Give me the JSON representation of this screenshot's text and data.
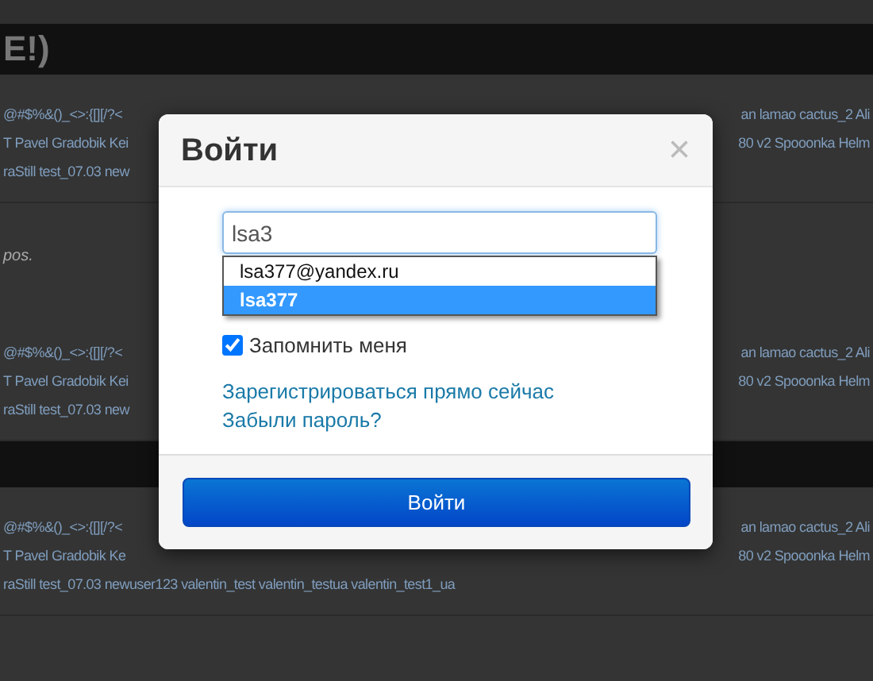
{
  "background": [
    {
      "kind": "heading",
      "text": "E!)"
    },
    {
      "kind": "posts",
      "lines": [
        {
          "left": "@#$%&()_<>:{[][/?<",
          "right": "an lamao cactus_2 Ali"
        },
        {
          "left": "T Pavel Gradobik Kei",
          "right": "80 v2 Spooonka Helm"
        },
        {
          "left": "raStill test_07.03 new"
        }
      ]
    },
    {
      "kind": "note",
      "text": "pos."
    },
    {
      "kind": "posts",
      "lines": [
        {
          "left": "@#$%&()_<>:{[][/?<",
          "right": "an lamao cactus_2 Ali"
        },
        {
          "left": "T Pavel Gradobik Kei",
          "right": "80 v2 Spooonka Helm"
        },
        {
          "left": "raStill test_07.03 new"
        }
      ]
    },
    {
      "kind": "heading"
    },
    {
      "kind": "posts",
      "lines": [
        {
          "left": "@#$%&()_<>:{[][/?<",
          "right": "an lamao cactus_2 Ali"
        },
        {
          "left": "T Pavel Gradobik Ke",
          "right": "80 v2 Spooonka Helm"
        },
        {
          "left": "raStill test_07.03 newuser123 valentin_test valentin_testua valentin_test1_ua"
        }
      ]
    }
  ],
  "dialog": {
    "title": "Войти",
    "close": "×",
    "login_field": {
      "value": "lsa3"
    },
    "suggestions": [
      {
        "text": "lsa377@yandex.ru",
        "selected": false
      },
      {
        "text": "lsa377",
        "selected": true
      }
    ],
    "remember": {
      "label": "Запомнить меня",
      "checked": true
    },
    "links": [
      "Зарегистрироваться прямо сейчас",
      "Забыли пароль?"
    ],
    "submit": "Войти"
  }
}
